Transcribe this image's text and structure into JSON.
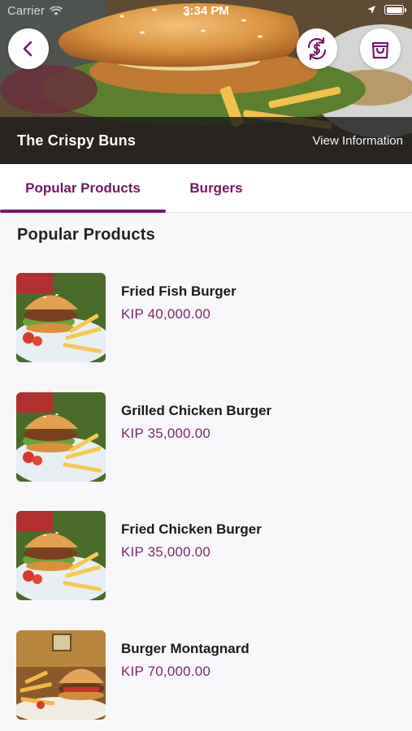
{
  "status_bar": {
    "carrier": "Carrier",
    "time": "3:34 PM",
    "battery_level": 1.0
  },
  "hero": {
    "store_name": "The Crispy Buns",
    "view_info_label": "View Information",
    "buttons": {
      "back_icon": "chevron-left-icon",
      "currency_icon": "currency-exchange-icon",
      "cart_icon": "shopping-bag-icon"
    }
  },
  "tabs": [
    {
      "label": "Popular Products",
      "active": true
    },
    {
      "label": "Burgers",
      "active": false
    }
  ],
  "section_title": "Popular Products",
  "products": [
    {
      "name": "Fried Fish Burger",
      "price": "KIP 40,000.00"
    },
    {
      "name": "Grilled Chicken Burger",
      "price": "KIP 35,000.00"
    },
    {
      "name": "Fried Chicken Burger",
      "price": "KIP 35,000.00"
    },
    {
      "name": "Burger Montagnard",
      "price": "KIP 70,000.00"
    }
  ],
  "colors": {
    "accent": "#6f1a62",
    "price": "#7b2d6b",
    "background": "#f8f8fb"
  }
}
